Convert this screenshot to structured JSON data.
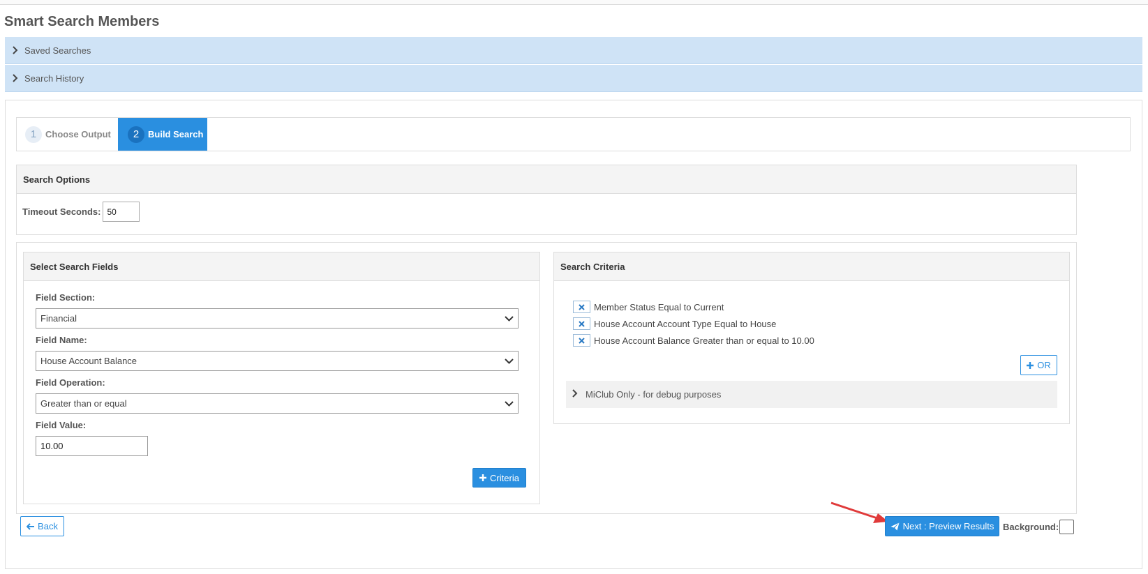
{
  "page": {
    "title": "Smart Search Members"
  },
  "accordions": {
    "saved_searches": "Saved Searches",
    "search_history": "Search History"
  },
  "wizard": {
    "steps": [
      {
        "number": "1",
        "label": "Choose Output",
        "active": false
      },
      {
        "number": "2",
        "label": "Build Search",
        "active": true
      }
    ]
  },
  "search_options": {
    "heading": "Search Options",
    "timeout_label": "Timeout Seconds:",
    "timeout_value": "50"
  },
  "select_fields": {
    "heading": "Select Search Fields",
    "field_section_label": "Field Section:",
    "field_section_value": "Financial",
    "field_name_label": "Field Name:",
    "field_name_value": "House Account Balance",
    "field_operation_label": "Field Operation:",
    "field_operation_value": "Greater than or equal",
    "field_value_label": "Field Value:",
    "field_value": "10.00",
    "add_criteria_label": "Criteria"
  },
  "search_criteria": {
    "heading": "Search Criteria",
    "items": [
      "Member Status Equal to Current",
      "House Account Account Type Equal to House",
      "House Account Balance Greater than or equal to 10.00"
    ],
    "or_label": "OR",
    "debug_label": "MiClub Only - for debug purposes"
  },
  "footer": {
    "back_label": "Back",
    "next_label": "Next : Preview Results",
    "background_label": "Background:"
  },
  "colors": {
    "accent": "#2a8fe0",
    "accordion_bg": "#cfe3f6",
    "annotation_arrow": "#e03a3a"
  },
  "icons": {
    "accordion": "chevron-right-icon",
    "remove": "close-icon",
    "add": "plus-icon",
    "back": "arrow-left-icon",
    "next": "paper-plane-icon",
    "select": "chevron-down-icon"
  }
}
